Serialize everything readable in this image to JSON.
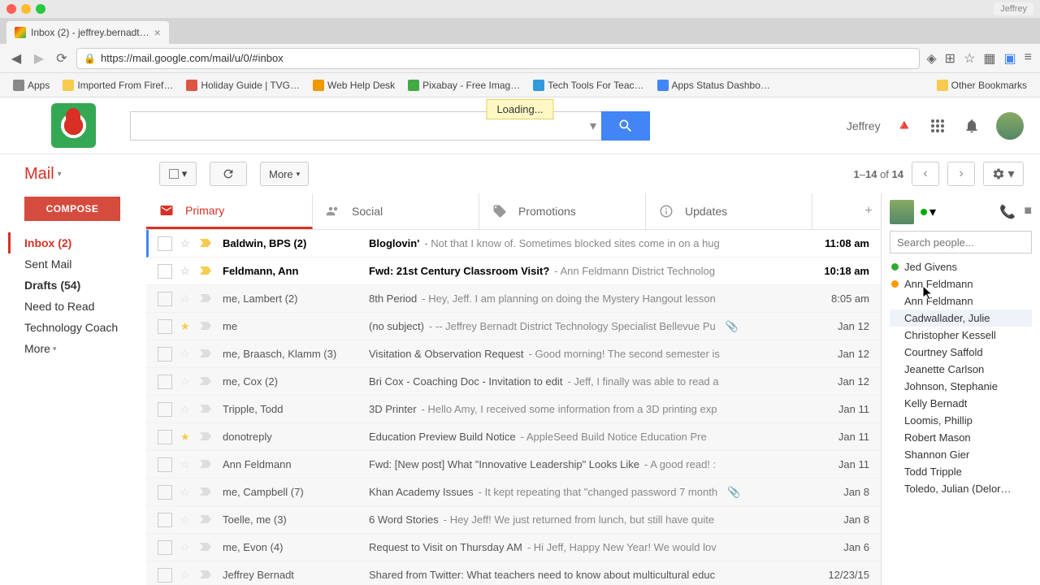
{
  "browser": {
    "tab_title": "Inbox (2) - jeffrey.bernadt…",
    "url": "https://mail.google.com/mail/u/0/#inbox",
    "user_button": "Jeffrey",
    "bookmarks": [
      {
        "label": "Apps"
      },
      {
        "label": "Imported From Firef…"
      },
      {
        "label": "Holiday Guide | TVG…"
      },
      {
        "label": "Web Help Desk"
      },
      {
        "label": "Pixabay - Free Imag…"
      },
      {
        "label": "Tech Tools For Teac…"
      },
      {
        "label": "Apps Status Dashbo…"
      }
    ],
    "other_bookmarks": "Other Bookmarks"
  },
  "header": {
    "loading": "Loading...",
    "user_name": "Jeffrey"
  },
  "toolbar": {
    "mail_label": "Mail",
    "more_label": "More",
    "page_count_html": "1–14 of 14"
  },
  "sidebar": {
    "compose": "COMPOSE",
    "items": [
      {
        "label": "Inbox (2)",
        "active": true
      },
      {
        "label": "Sent Mail"
      },
      {
        "label": "Drafts (54)",
        "bold": true
      },
      {
        "label": "Need to Read"
      },
      {
        "label": "Technology Coach"
      }
    ],
    "more": "More"
  },
  "tabs": [
    {
      "label": "Primary",
      "active": true
    },
    {
      "label": "Social"
    },
    {
      "label": "Promotions"
    },
    {
      "label": "Updates"
    }
  ],
  "mails": [
    {
      "unread": true,
      "star": false,
      "important": true,
      "sender": "Baldwin, BPS (2)",
      "subject": "Bloglovin'",
      "snippet": " - Not that I know of. Sometimes blocked sites come in on a hug",
      "date": "11:08 am"
    },
    {
      "unread": true,
      "star": false,
      "important": true,
      "sender": "Feldmann, Ann",
      "subject": "Fwd: 21st Century Classroom Visit?",
      "snippet": " - Ann Feldmann District Technolog",
      "date": "10:18 am"
    },
    {
      "unread": false,
      "star": false,
      "important": false,
      "sender": "me, Lambert (2)",
      "subject": "8th Period",
      "snippet": " - Hey, Jeff. I am planning on doing the Mystery Hangout lesson",
      "date": "8:05 am"
    },
    {
      "unread": false,
      "star": true,
      "important": false,
      "sender": "me",
      "subject": "(no subject)",
      "snippet": " - -- Jeffrey Bernadt District Technology Specialist Bellevue Pu",
      "date": "Jan 12",
      "attach": true
    },
    {
      "unread": false,
      "star": false,
      "important": false,
      "sender": "me, Braasch, Klamm (3)",
      "subject": "Visitation & Observation Request",
      "snippet": " - Good morning! The second semester is",
      "date": "Jan 12"
    },
    {
      "unread": false,
      "star": false,
      "important": false,
      "sender": "me, Cox (2)",
      "subject": "Bri Cox - Coaching Doc - Invitation to edit",
      "snippet": " - Jeff, I finally was able to read a",
      "date": "Jan 12"
    },
    {
      "unread": false,
      "star": false,
      "important": false,
      "sender": "Tripple, Todd",
      "subject": "3D Printer",
      "snippet": " - Hello Amy, I received some information from a 3D printing exp",
      "date": "Jan 11"
    },
    {
      "unread": false,
      "star": true,
      "important": false,
      "sender": "donotreply",
      "subject": "Education Preview Build Notice",
      "snippet": " -  AppleSeed Build Notice Education Pre",
      "date": "Jan 11"
    },
    {
      "unread": false,
      "star": false,
      "important": false,
      "sender": "Ann Feldmann",
      "subject": "Fwd: [New post] What \"Innovative Leadership\" Looks Like",
      "snippet": " - A good read! :",
      "date": "Jan 11"
    },
    {
      "unread": false,
      "star": false,
      "important": false,
      "sender": "me, Campbell (7)",
      "subject": "Khan Academy Issues",
      "snippet": " - It kept repeating that \"changed password 7 month",
      "date": "Jan 8",
      "attach": true
    },
    {
      "unread": false,
      "star": false,
      "important": false,
      "sender": "Toelle, me (3)",
      "subject": "6 Word Stories",
      "snippet": " - Hey Jeff! We just returned from lunch, but still have quite",
      "date": "Jan 8"
    },
    {
      "unread": false,
      "star": false,
      "important": false,
      "sender": "me, Evon (4)",
      "subject": "Request to Visit on Thursday AM",
      "snippet": " - Hi Jeff, Happy New Year! We would lov",
      "date": "Jan 6"
    },
    {
      "unread": false,
      "star": false,
      "important": false,
      "sender": "Jeffrey Bernadt",
      "subject": "Shared from Twitter: What teachers need to know about multicultural educ",
      "snippet": "",
      "date": "12/23/15"
    }
  ],
  "chat": {
    "search_placeholder": "Search people...",
    "people": [
      {
        "name": "Jed Givens",
        "status": "green"
      },
      {
        "name": "Ann Feldmann",
        "status": "orange"
      },
      {
        "name": "Ann Feldmann",
        "status": "none"
      },
      {
        "name": "Cadwallader, Julie",
        "status": "none",
        "hover": true
      },
      {
        "name": "Christopher Kessell",
        "status": "none"
      },
      {
        "name": "Courtney Saffold",
        "status": "none"
      },
      {
        "name": "Jeanette Carlson",
        "status": "none"
      },
      {
        "name": "Johnson, Stephanie",
        "status": "none"
      },
      {
        "name": "Kelly Bernadt",
        "status": "none"
      },
      {
        "name": "Loomis, Phillip",
        "status": "none"
      },
      {
        "name": "Robert Mason",
        "status": "none"
      },
      {
        "name": "Shannon Gier",
        "status": "none"
      },
      {
        "name": "Todd Tripple",
        "status": "none"
      },
      {
        "name": "Toledo, Julian (Delor…",
        "status": "none"
      }
    ]
  }
}
